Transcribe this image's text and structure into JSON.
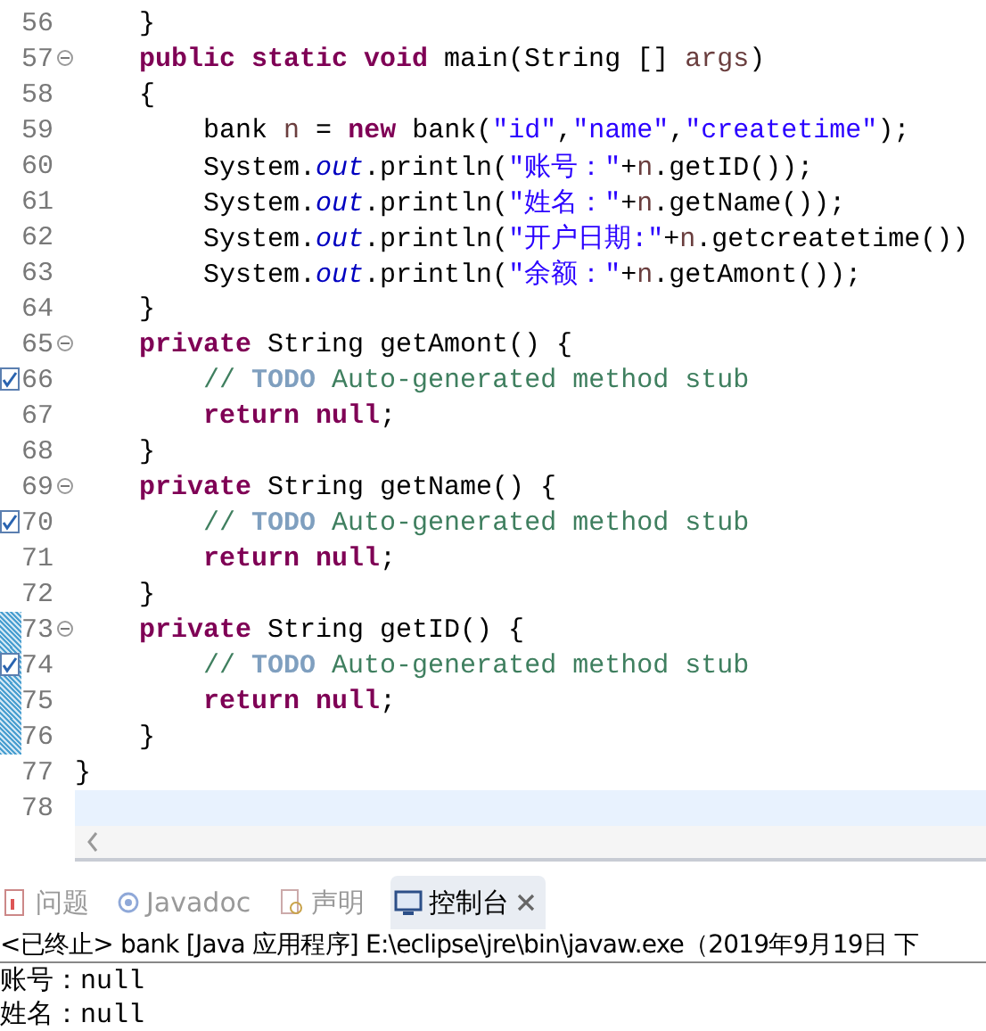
{
  "editor": {
    "lines": [
      {
        "number": "56",
        "tokens": [
          {
            "kind": "plain",
            "text": "    }"
          }
        ]
      },
      {
        "number": "57",
        "fold": true,
        "tokens": [
          {
            "kind": "keyword",
            "text": "    public static void"
          },
          {
            "kind": "plain",
            "text": " main(String [] "
          },
          {
            "kind": "param",
            "text": "args"
          },
          {
            "kind": "plain",
            "text": ")"
          }
        ]
      },
      {
        "number": "58",
        "tokens": [
          {
            "kind": "plain",
            "text": "    {"
          }
        ]
      },
      {
        "number": "59",
        "tokens": [
          {
            "kind": "plain",
            "text": "        bank "
          },
          {
            "kind": "local",
            "text": "n"
          },
          {
            "kind": "plain",
            "text": " = "
          },
          {
            "kind": "keyword",
            "text": "new"
          },
          {
            "kind": "plain",
            "text": " bank("
          },
          {
            "kind": "string",
            "text": "\"id\""
          },
          {
            "kind": "plain",
            "text": ","
          },
          {
            "kind": "string",
            "text": "\"name\""
          },
          {
            "kind": "plain",
            "text": ","
          },
          {
            "kind": "string",
            "text": "\"createtime\""
          },
          {
            "kind": "plain",
            "text": ");"
          }
        ]
      },
      {
        "number": "60",
        "tokens": [
          {
            "kind": "plain",
            "text": "        System."
          },
          {
            "kind": "field",
            "text": "out"
          },
          {
            "kind": "plain",
            "text": ".println("
          },
          {
            "kind": "string",
            "text": "\"账号：\""
          },
          {
            "kind": "plain",
            "text": "+"
          },
          {
            "kind": "local",
            "text": "n"
          },
          {
            "kind": "plain",
            "text": ".getID());"
          }
        ]
      },
      {
        "number": "61",
        "tokens": [
          {
            "kind": "plain",
            "text": "        System."
          },
          {
            "kind": "field",
            "text": "out"
          },
          {
            "kind": "plain",
            "text": ".println("
          },
          {
            "kind": "string",
            "text": "\"姓名：\""
          },
          {
            "kind": "plain",
            "text": "+"
          },
          {
            "kind": "local",
            "text": "n"
          },
          {
            "kind": "plain",
            "text": ".getName());"
          }
        ]
      },
      {
        "number": "62",
        "tokens": [
          {
            "kind": "plain",
            "text": "        System."
          },
          {
            "kind": "field",
            "text": "out"
          },
          {
            "kind": "plain",
            "text": ".println("
          },
          {
            "kind": "string",
            "text": "\"开户日期:\""
          },
          {
            "kind": "plain",
            "text": "+"
          },
          {
            "kind": "local",
            "text": "n"
          },
          {
            "kind": "plain",
            "text": ".getcreatetime())"
          }
        ]
      },
      {
        "number": "63",
        "tokens": [
          {
            "kind": "plain",
            "text": "        System."
          },
          {
            "kind": "field",
            "text": "out"
          },
          {
            "kind": "plain",
            "text": ".println("
          },
          {
            "kind": "string",
            "text": "\"余额：\""
          },
          {
            "kind": "plain",
            "text": "+"
          },
          {
            "kind": "local",
            "text": "n"
          },
          {
            "kind": "plain",
            "text": ".getAmont());"
          }
        ]
      },
      {
        "number": "64",
        "tokens": [
          {
            "kind": "plain",
            "text": "    }"
          }
        ]
      },
      {
        "number": "65",
        "fold": true,
        "tokens": [
          {
            "kind": "keyword",
            "text": "    private"
          },
          {
            "kind": "plain",
            "text": " String getAmont() {"
          }
        ]
      },
      {
        "number": "66",
        "task": true,
        "tokens": [
          {
            "kind": "comment",
            "text": "        // "
          },
          {
            "kind": "todo",
            "text": "TODO"
          },
          {
            "kind": "comment",
            "text": " Auto-generated method stub"
          }
        ]
      },
      {
        "number": "67",
        "tokens": [
          {
            "kind": "keyword",
            "text": "        return null"
          },
          {
            "kind": "plain",
            "text": ";"
          }
        ]
      },
      {
        "number": "68",
        "tokens": [
          {
            "kind": "plain",
            "text": "    }"
          }
        ]
      },
      {
        "number": "69",
        "fold": true,
        "tokens": [
          {
            "kind": "keyword",
            "text": "    private"
          },
          {
            "kind": "plain",
            "text": " String getName() {"
          }
        ]
      },
      {
        "number": "70",
        "task": true,
        "tokens": [
          {
            "kind": "comment",
            "text": "        // "
          },
          {
            "kind": "todo",
            "text": "TODO"
          },
          {
            "kind": "comment",
            "text": " Auto-generated method stub"
          }
        ]
      },
      {
        "number": "71",
        "tokens": [
          {
            "kind": "keyword",
            "text": "        return null"
          },
          {
            "kind": "plain",
            "text": ";"
          }
        ]
      },
      {
        "number": "72",
        "tokens": [
          {
            "kind": "plain",
            "text": "    }"
          }
        ]
      },
      {
        "number": "73",
        "fold": true,
        "overview": true,
        "tokens": [
          {
            "kind": "keyword",
            "text": "    private"
          },
          {
            "kind": "plain",
            "text": " String getID() {"
          }
        ]
      },
      {
        "number": "74",
        "task": true,
        "overview": true,
        "tokens": [
          {
            "kind": "comment",
            "text": "        // "
          },
          {
            "kind": "todo",
            "text": "TODO"
          },
          {
            "kind": "comment",
            "text": " Auto-generated method stub"
          }
        ]
      },
      {
        "number": "75",
        "overview": true,
        "tokens": [
          {
            "kind": "keyword",
            "text": "        return null"
          },
          {
            "kind": "plain",
            "text": ";"
          }
        ]
      },
      {
        "number": "76",
        "overview": true,
        "tokens": [
          {
            "kind": "plain",
            "text": "    }"
          }
        ]
      },
      {
        "number": "77",
        "tokens": [
          {
            "kind": "plain",
            "text": "}"
          }
        ]
      },
      {
        "number": "78",
        "current": true
      }
    ]
  },
  "views": {
    "tabs": [
      {
        "kind": "problems",
        "label": "问题",
        "selected": false
      },
      {
        "kind": "javadoc",
        "label": "Javadoc",
        "selected": false
      },
      {
        "kind": "declaration",
        "label": "声明",
        "selected": false
      },
      {
        "kind": "console",
        "label": "控制台",
        "selected": true,
        "closable": true
      }
    ]
  },
  "console": {
    "header": "<已终止> bank [Java 应用程序] E:\\eclipse\\jre\\bin\\javaw.exe（2019年9月19日 下",
    "output": [
      "账号：null",
      "姓名：null"
    ]
  }
}
